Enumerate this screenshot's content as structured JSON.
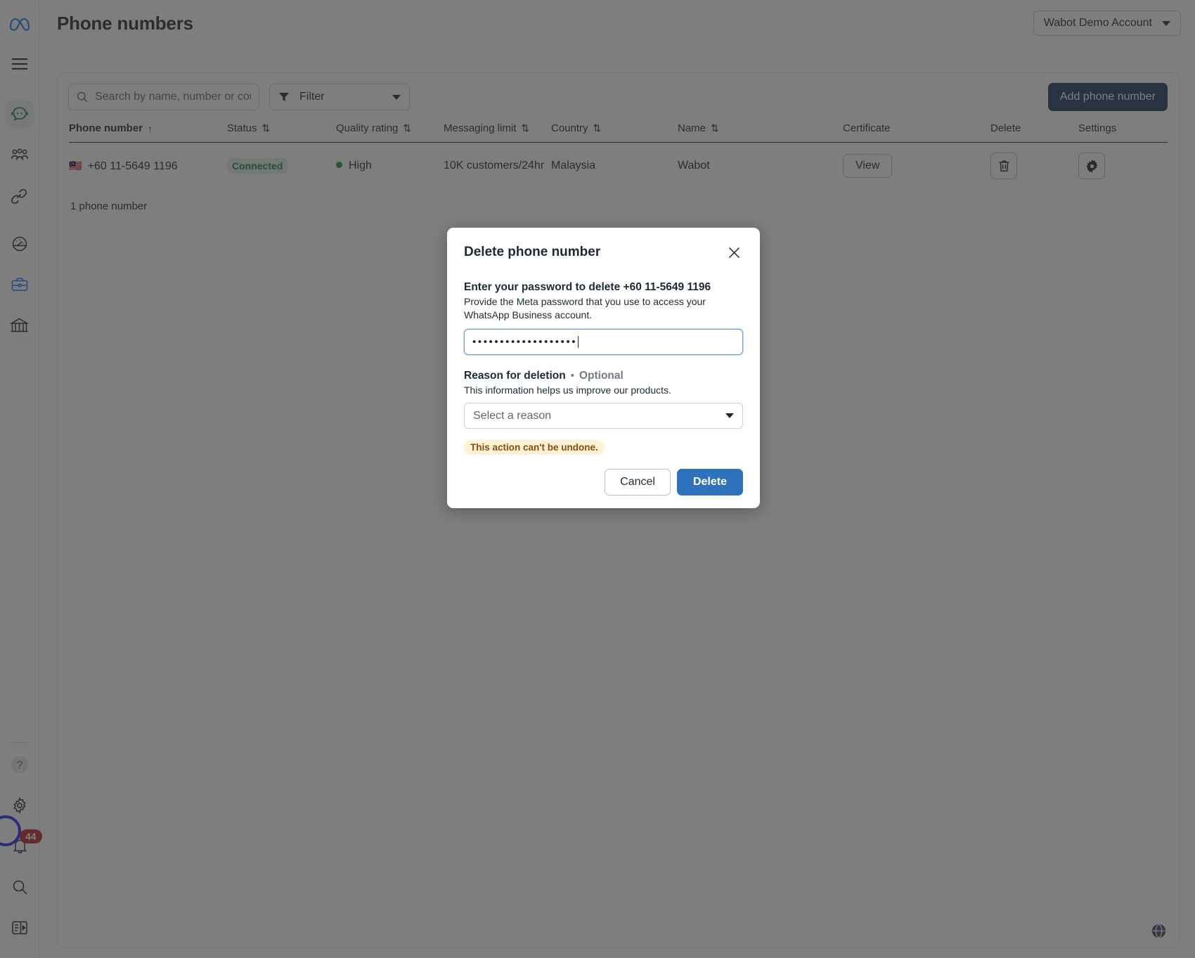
{
  "header": {
    "page_title": "Phone numbers",
    "account_label": "Wabot Demo Account"
  },
  "sidebar": {
    "items": [
      {
        "name": "meta-logo",
        "label": "Meta"
      },
      {
        "name": "menu",
        "label": "Menu"
      },
      {
        "name": "whatsapp-manager",
        "label": "WhatsApp Manager"
      },
      {
        "name": "users",
        "label": "Users"
      },
      {
        "name": "links",
        "label": "Linked accounts"
      },
      {
        "name": "insights",
        "label": "Insights"
      },
      {
        "name": "business-assets",
        "label": "Business assets"
      },
      {
        "name": "billing",
        "label": "Billing"
      }
    ],
    "bottom_items": [
      {
        "name": "help",
        "label": "Help"
      },
      {
        "name": "settings",
        "label": "Settings"
      },
      {
        "name": "notifications",
        "label": "Notifications",
        "badge": "44"
      },
      {
        "name": "search",
        "label": "Search"
      },
      {
        "name": "panel",
        "label": "Panel"
      }
    ]
  },
  "toolbar": {
    "search_placeholder": "Search by name, number or country",
    "search_value": "",
    "filter_label": "Filter",
    "add_button": "Add phone number"
  },
  "table": {
    "columns": [
      {
        "label": "Phone number",
        "sort": "↑",
        "strong": true
      },
      {
        "label": "Status",
        "sort": "⇅",
        "strong": false
      },
      {
        "label": "Quality rating",
        "sort": "⇅",
        "strong": false
      },
      {
        "label": "Messaging limit",
        "sort": "⇅",
        "strong": false
      },
      {
        "label": "Country",
        "sort": "⇅",
        "strong": false
      },
      {
        "label": "Name",
        "sort": "⇅",
        "strong": false
      },
      {
        "label": "Certificate",
        "sort": "",
        "strong": false
      },
      {
        "label": "Delete",
        "sort": "",
        "strong": false
      },
      {
        "label": "Settings",
        "sort": "",
        "strong": false
      }
    ],
    "rows": [
      {
        "flag": "🇲🇾",
        "phone_number": "+60 11-5649 1196",
        "status": "Connected",
        "quality_rating": "High",
        "messaging_limit": "10K customers/24hr",
        "country": "Malaysia",
        "name": "Wabot",
        "certificate_button": "View"
      }
    ],
    "footer_count": "1 phone number"
  },
  "modal": {
    "title": "Delete phone number",
    "password_label": "Enter your password to delete +60 11-5649 1196",
    "password_help": "Provide the Meta password that you use to access your WhatsApp Business account.",
    "password_value": "•••••••••••••••••••",
    "reason_label": "Reason for deletion",
    "reason_optional": "Optional",
    "reason_separator": "•",
    "reason_help": "This information helps us improve our products.",
    "reason_placeholder": "Select a reason",
    "warning": "This action can't be undone.",
    "cancel_button": "Cancel",
    "delete_button": "Delete"
  },
  "colors": {
    "accent_blue": "#2e72bb",
    "navy": "#1c3a5e",
    "connected_green": "#1a7f4b",
    "quality_green": "#1a9c42",
    "warn_bg": "#fdf2d4",
    "warn_text": "#8a4b12",
    "badge_red": "#b5272b"
  }
}
